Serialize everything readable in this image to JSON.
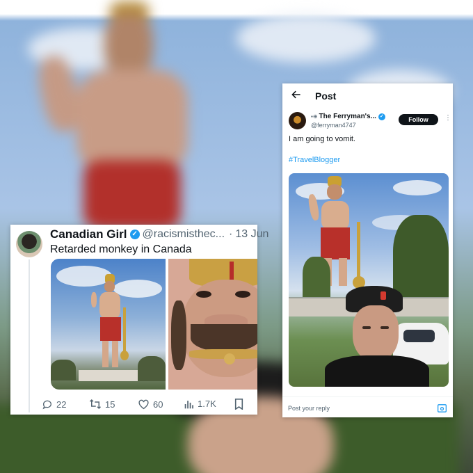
{
  "left_tweet": {
    "name": "Canadian Girl",
    "handle": "@racismisthec...",
    "separator": "·",
    "date": "13 Jun",
    "text": "Retarded monkey in Canada",
    "actions": {
      "replies": "22",
      "reposts": "15",
      "likes": "60",
      "views": "1.7K"
    }
  },
  "right_post": {
    "header_title": "Post",
    "author_flags": "▪⊕",
    "author_name": "The Ferryman's...",
    "author_handle": "@ferryman4747",
    "follow_label": "Follow",
    "more": "⋮",
    "text": "I am going to vomit.",
    "hashtag": "#TravelBlogger",
    "reply_placeholder": "Post your reply"
  },
  "colors": {
    "verified_blue": "#1d9bf0",
    "text_primary": "#0f1419",
    "text_secondary": "#536471",
    "follow_button": "#0f1419"
  },
  "icons": [
    "back-arrow-icon",
    "verified-icon",
    "reply-icon",
    "repost-icon",
    "like-icon",
    "views-icon",
    "bookmark-icon",
    "image-icon",
    "more-icon"
  ]
}
